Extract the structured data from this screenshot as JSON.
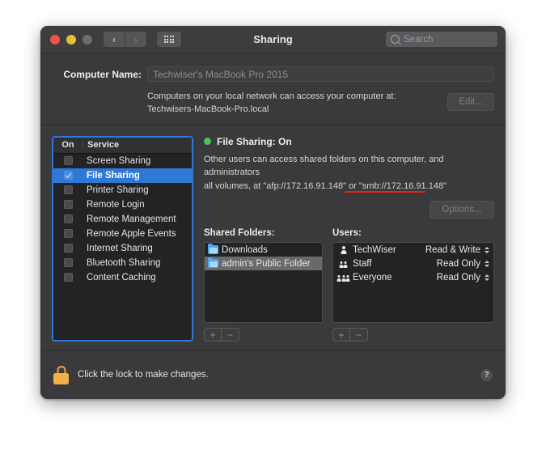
{
  "window": {
    "title": "Sharing",
    "traffic_lights": [
      "close",
      "minimize",
      "zoom"
    ],
    "nav_back": "‹",
    "nav_forward": "›",
    "grid_icon": "grid-view-icon",
    "search": {
      "placeholder": "Search",
      "value": ""
    }
  },
  "computer_name": {
    "label": "Computer Name:",
    "value": "Techwiser's MacBook Pro 2015",
    "description_line1": "Computers on your local network can access your computer at:",
    "description_line2": "Techwisers-MacBook-Pro.local",
    "edit_label": "Edit..."
  },
  "services": {
    "header_on": "On",
    "header_service": "Service",
    "items": [
      {
        "name": "Screen Sharing",
        "on": false,
        "selected": false
      },
      {
        "name": "File Sharing",
        "on": true,
        "selected": true
      },
      {
        "name": "Printer Sharing",
        "on": false,
        "selected": false
      },
      {
        "name": "Remote Login",
        "on": false,
        "selected": false
      },
      {
        "name": "Remote Management",
        "on": false,
        "selected": false
      },
      {
        "name": "Remote Apple Events",
        "on": false,
        "selected": false
      },
      {
        "name": "Internet Sharing",
        "on": false,
        "selected": false
      },
      {
        "name": "Bluetooth Sharing",
        "on": false,
        "selected": false
      },
      {
        "name": "Content Caching",
        "on": false,
        "selected": false
      }
    ]
  },
  "detail": {
    "status_text": "File Sharing: On",
    "status_color": "#3ec65a",
    "description_line1": "Other users can access shared folders on this computer, and administrators",
    "description_line2": "all volumes, at \"afp://172.16.91.148\" or \"smb://172.16.91.148\"",
    "annotation_color": "#f0201a",
    "options_label": "Options...",
    "shared_folders_label": "Shared Folders:",
    "users_label": "Users:",
    "shared_folders": [
      {
        "name": "Downloads",
        "selected": false
      },
      {
        "name": "admin's Public Folder",
        "selected": true
      }
    ],
    "users": [
      {
        "name": "TechWiser",
        "icon": "single-person-icon",
        "permission": "Read & Write"
      },
      {
        "name": "Staff",
        "icon": "two-person-icon",
        "permission": "Read Only"
      },
      {
        "name": "Everyone",
        "icon": "three-person-icon",
        "permission": "Read Only"
      }
    ],
    "add_label": "+",
    "remove_label": "−"
  },
  "footer": {
    "lock_icon": "lock-closed-icon",
    "lock_text": "Click the lock to make changes.",
    "help_label": "?"
  }
}
